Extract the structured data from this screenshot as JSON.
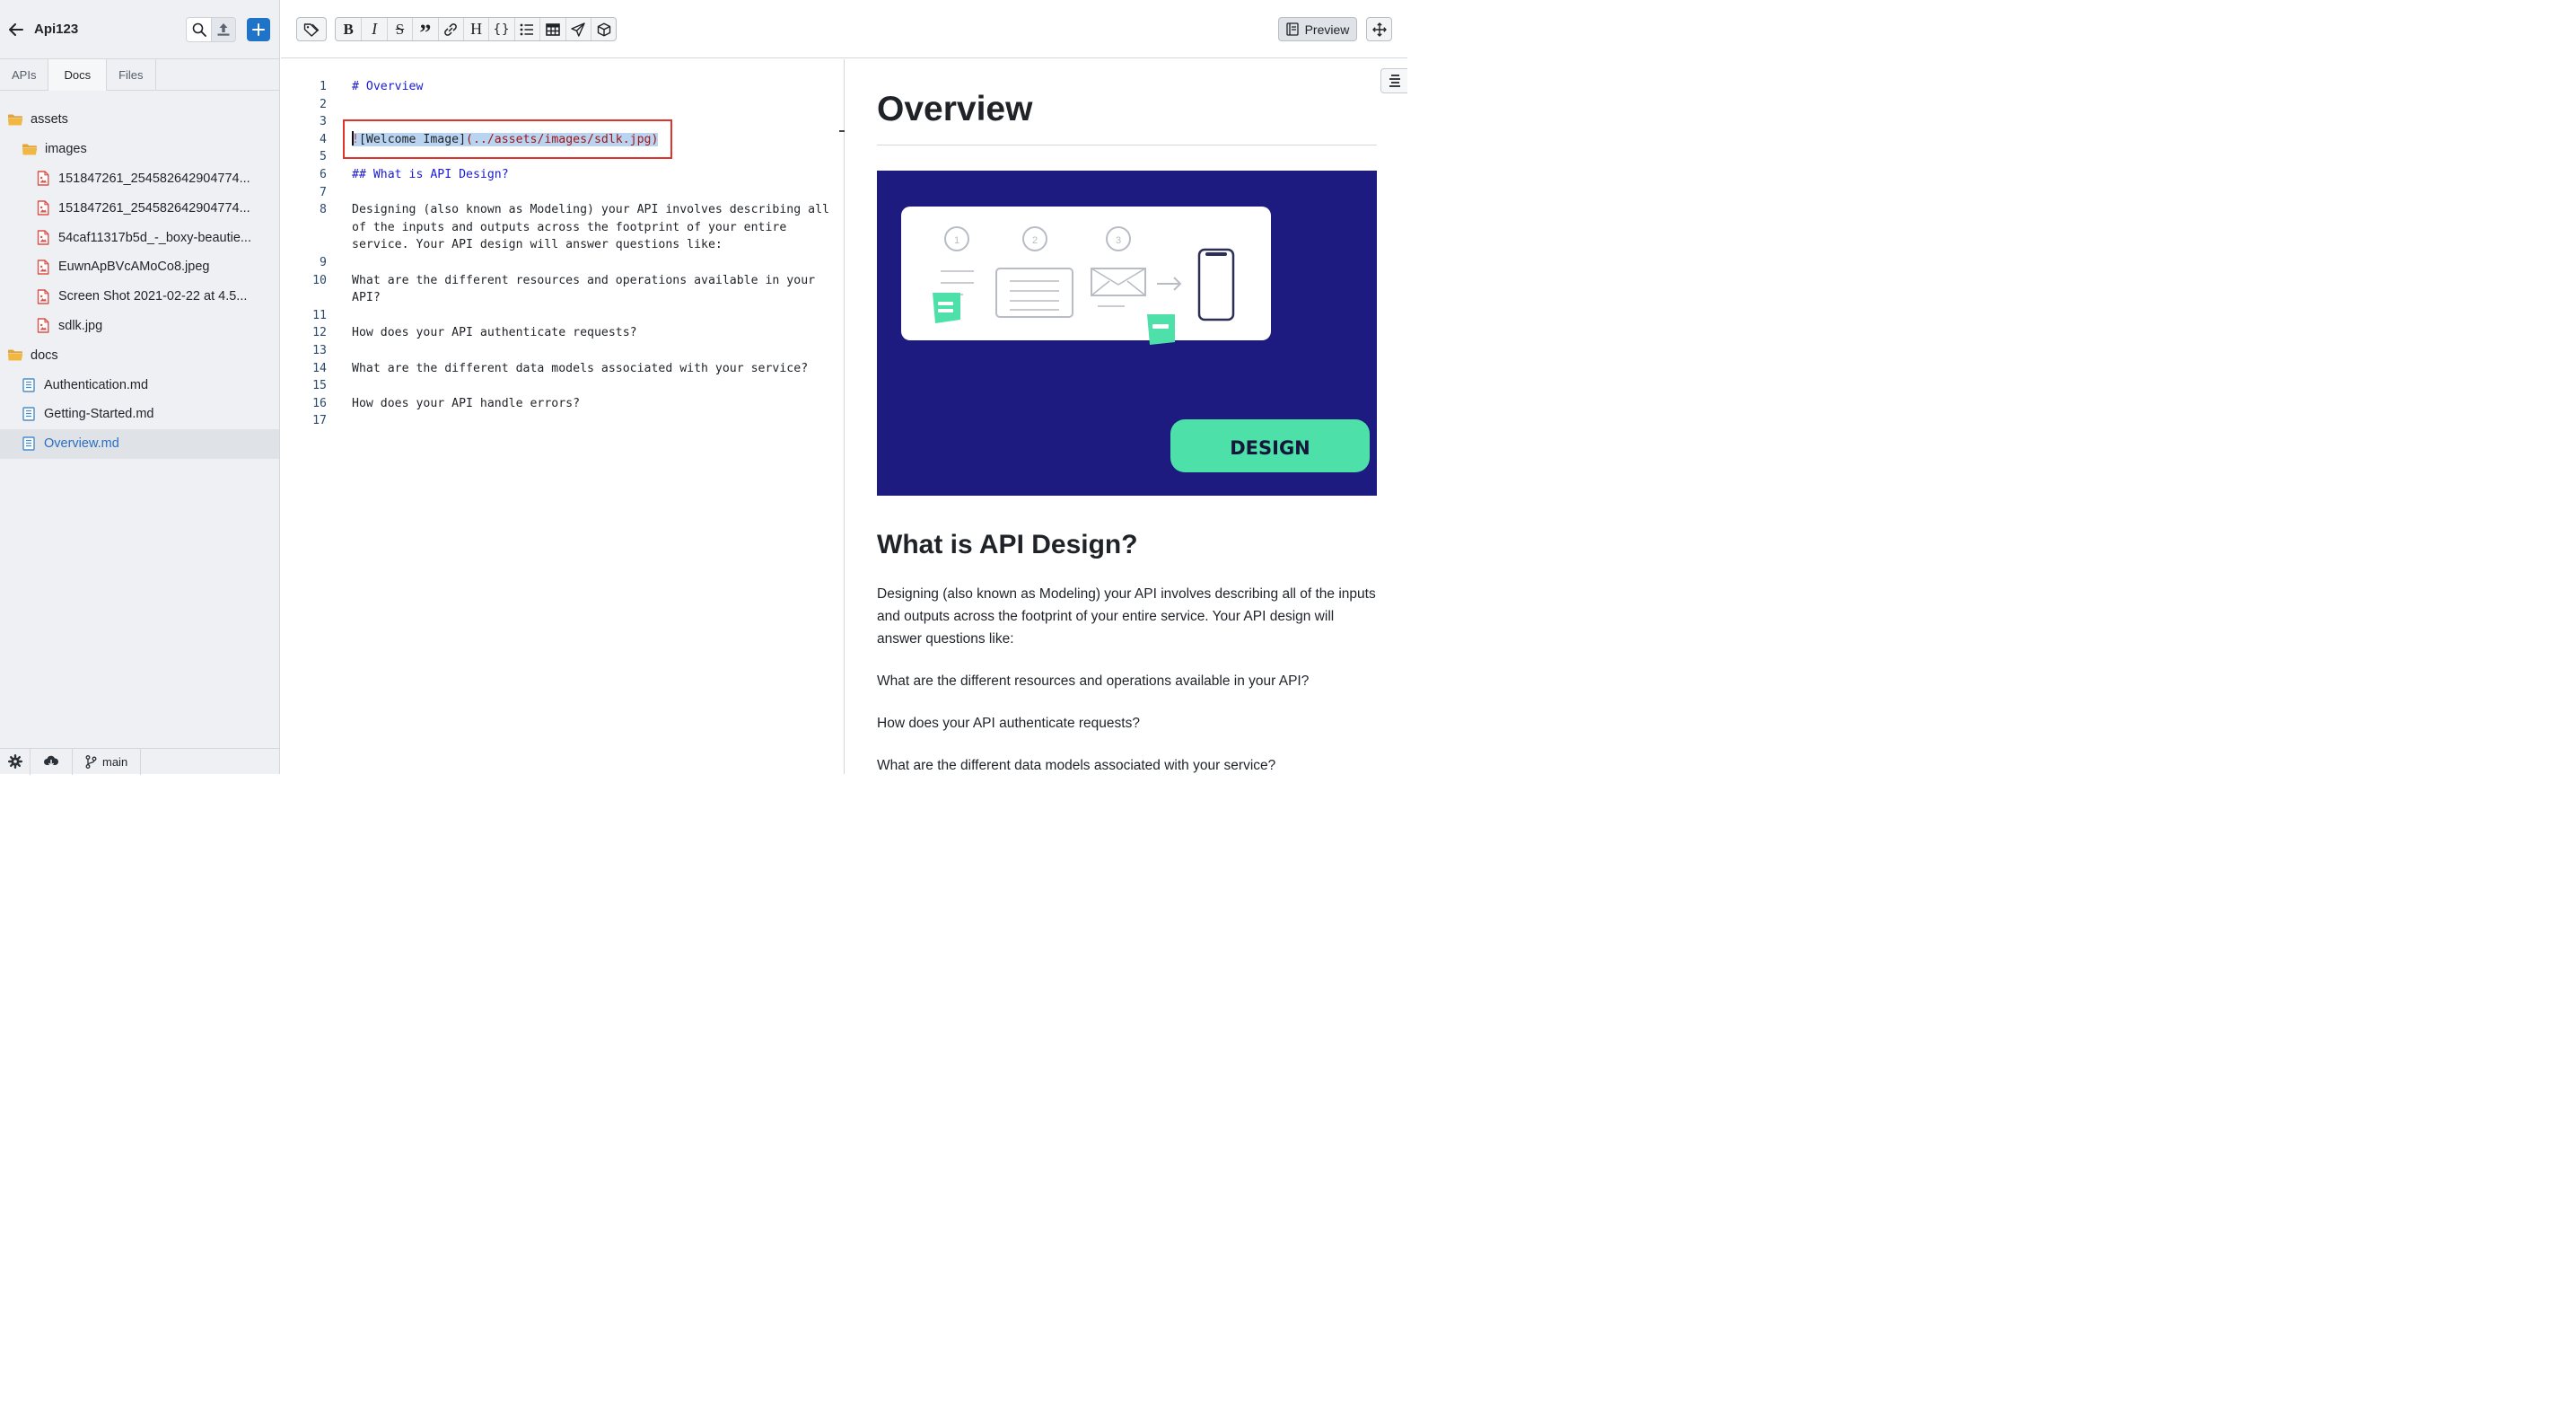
{
  "sidebar": {
    "project_title": "Api123",
    "tabs": [
      {
        "label": "APIs",
        "active": false
      },
      {
        "label": "Docs",
        "active": true
      },
      {
        "label": "Files",
        "active": false
      }
    ],
    "tree": [
      {
        "label": "assets",
        "type": "folder",
        "level": 0
      },
      {
        "label": "images",
        "type": "folder",
        "level": 1
      },
      {
        "label": "151847261_254582642904774...",
        "type": "image-file",
        "level": 2
      },
      {
        "label": "151847261_254582642904774...",
        "type": "image-file",
        "level": 2
      },
      {
        "label": "54caf11317b5d_-_boxy-beautie...",
        "type": "image-file",
        "level": 2
      },
      {
        "label": "EuwnApBVcAMoCo8.jpeg",
        "type": "image-file",
        "level": 2
      },
      {
        "label": "Screen Shot 2021-02-22 at 4.5...",
        "type": "image-file",
        "level": 2
      },
      {
        "label": "sdlk.jpg",
        "type": "image-file",
        "level": 2
      },
      {
        "label": "docs",
        "type": "folder",
        "level": 0
      },
      {
        "label": "Authentication.md",
        "type": "doc-file",
        "level": 1
      },
      {
        "label": "Getting-Started.md",
        "type": "doc-file",
        "level": 1
      },
      {
        "label": "Overview.md",
        "type": "doc-file",
        "level": 1,
        "selected": true
      }
    ],
    "footer": {
      "branch": "main"
    }
  },
  "toolbar": {
    "format_buttons": [
      "bold",
      "italic",
      "strikethrough",
      "quote",
      "link",
      "heading",
      "code",
      "bullet-list",
      "table",
      "send",
      "box"
    ],
    "preview_label": "Preview"
  },
  "editor": {
    "lines": [
      {
        "n": "1",
        "text": "# Overview"
      },
      {
        "n": "2",
        "text": ""
      },
      {
        "n": "3",
        "text": ""
      },
      {
        "n": "4",
        "bang": "!",
        "text": "[Welcome Image]",
        "url": "(../assets/images/sdlk.jpg)"
      },
      {
        "n": "5",
        "text": ""
      },
      {
        "n": "6",
        "text": "## What is API Design?"
      },
      {
        "n": "7",
        "text": ""
      },
      {
        "n": "8",
        "text": "Designing (also known as Modeling) your API involves describing all"
      },
      {
        "n": "",
        "text": "of the inputs and outputs across the footprint of your entire"
      },
      {
        "n": "",
        "text": "service. Your API design will answer questions like:"
      },
      {
        "n": "9",
        "text": ""
      },
      {
        "n": "10",
        "text": "What are the different resources and operations available in your"
      },
      {
        "n": "",
        "text": "API?"
      },
      {
        "n": "11",
        "text": ""
      },
      {
        "n": "12",
        "text": "How does your API authenticate requests?"
      },
      {
        "n": "13",
        "text": ""
      },
      {
        "n": "14",
        "text": "What are the different data models associated with your service?"
      },
      {
        "n": "15",
        "text": ""
      },
      {
        "n": "16",
        "text": "How does your API handle errors?"
      },
      {
        "n": "17",
        "text": ""
      }
    ]
  },
  "preview": {
    "h1": "Overview",
    "image_badge": "DESIGN",
    "steps": [
      "1",
      "2",
      "3"
    ],
    "h2": "What is API Design?",
    "paragraph1": "Designing (also known as Modeling) your API involves describing all of the inputs and outputs across the footprint of your entire service. Your API design will answer questions like:",
    "paragraph2": "What are the different resources and operations available in your API?",
    "paragraph3": "How does your API authenticate requests?",
    "paragraph4": "What are the different data models associated with your service?"
  },
  "colors": {
    "accent": "#1f74c9",
    "highlight_box": "#e0332b",
    "image_bg": "#1d1a80",
    "image_mint": "#4de0a8"
  }
}
